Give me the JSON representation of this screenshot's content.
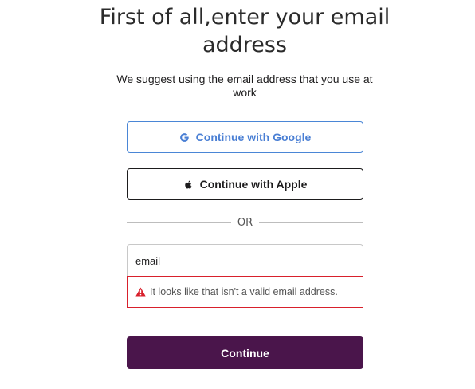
{
  "header": {
    "title_line1": "First of all,enter your email",
    "title_line2": "address",
    "subtitle": "We suggest using the email address that you use at work"
  },
  "auth": {
    "google_label": "Continue with Google",
    "apple_label": "Continue with Apple",
    "divider_label": "OR",
    "google_icon": "google-g-icon",
    "apple_icon": "apple-logo-icon"
  },
  "form": {
    "email_value": "email",
    "error_message": "It looks like that isn't a valid email address.",
    "error_icon": "warning-triangle-icon",
    "continue_label": "Continue"
  },
  "colors": {
    "google_blue": "#4a7fd4",
    "error_red": "#d8202c",
    "continue_bg": "#4a154b"
  }
}
